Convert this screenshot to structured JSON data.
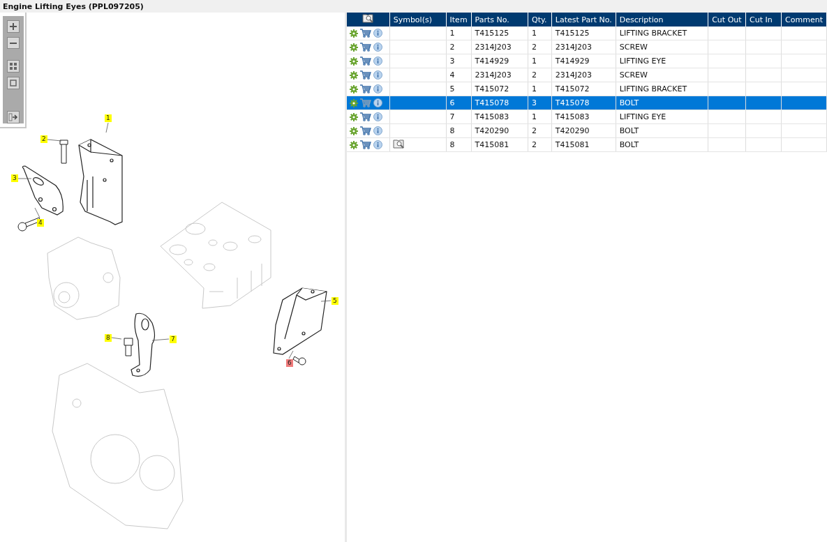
{
  "window": {
    "title": "Engine Lifting Eyes (PPL097205)"
  },
  "diagram": {
    "callouts": [
      {
        "label": "1",
        "selected": false
      },
      {
        "label": "2",
        "selected": false
      },
      {
        "label": "3",
        "selected": false
      },
      {
        "label": "4",
        "selected": false
      },
      {
        "label": "5",
        "selected": false
      },
      {
        "label": "6",
        "selected": true
      },
      {
        "label": "7",
        "selected": false
      },
      {
        "label": "8",
        "selected": false
      }
    ]
  },
  "table": {
    "columns": [
      "Symbol(s)",
      "Item",
      "Parts No.",
      "Qty.",
      "Latest Part No.",
      "Description",
      "Cut Out",
      "Cut In",
      "Comment"
    ],
    "rows": [
      {
        "symbol": false,
        "item": "1",
        "part_no": "T415125",
        "qty": "1",
        "latest": "T415125",
        "description": "LIFTING BRACKET",
        "selected": false
      },
      {
        "symbol": false,
        "item": "2",
        "part_no": "2314J203",
        "qty": "2",
        "latest": "2314J203",
        "description": "SCREW",
        "selected": false
      },
      {
        "symbol": false,
        "item": "3",
        "part_no": "T414929",
        "qty": "1",
        "latest": "T414929",
        "description": "LIFTING EYE",
        "selected": false
      },
      {
        "symbol": false,
        "item": "4",
        "part_no": "2314J203",
        "qty": "2",
        "latest": "2314J203",
        "description": "SCREW",
        "selected": false
      },
      {
        "symbol": false,
        "item": "5",
        "part_no": "T415072",
        "qty": "1",
        "latest": "T415072",
        "description": "LIFTING BRACKET",
        "selected": false
      },
      {
        "symbol": false,
        "item": "6",
        "part_no": "T415078",
        "qty": "3",
        "latest": "T415078",
        "description": "BOLT",
        "selected": true
      },
      {
        "symbol": false,
        "item": "7",
        "part_no": "T415083",
        "qty": "1",
        "latest": "T415083",
        "description": "LIFTING EYE",
        "selected": false
      },
      {
        "symbol": false,
        "item": "8",
        "part_no": "T420290",
        "qty": "2",
        "latest": "T420290",
        "description": "BOLT",
        "selected": false
      },
      {
        "symbol": true,
        "item": "8",
        "part_no": "T415081",
        "qty": "2",
        "latest": "T415081",
        "description": "BOLT",
        "selected": false
      }
    ]
  }
}
